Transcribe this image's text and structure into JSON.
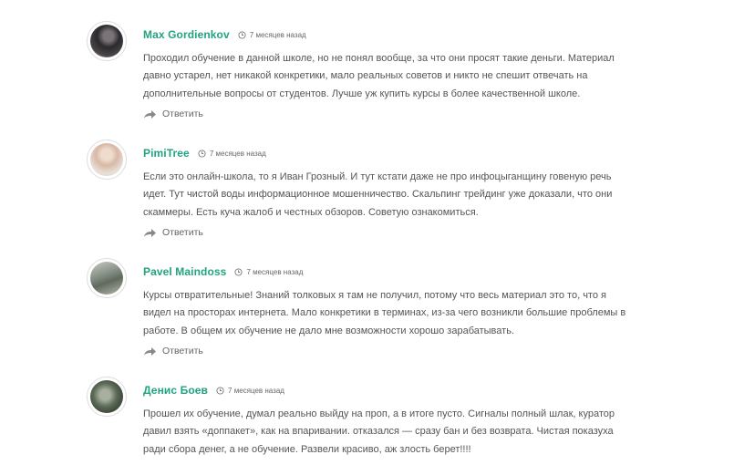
{
  "comments": [
    {
      "author": "Max Gordienkov",
      "time": "7 месяцев назад",
      "text": "Проходил обучение в данной школе, но не понял вообще, за что они просят такие деньги. Материал давно устарел, нет никакой конкретики, мало реальных советов и никто не спешит отвечать на дополнительные вопросы от студентов. Лучше уж купить курсы в более качественной школе.",
      "reply": "Ответить",
      "avatar_color": "#3c3a3e"
    },
    {
      "author": "PimiTree",
      "time": "7 месяцев назад",
      "text": "Если это онлайн-школа, то я Иван Грозный. И тут кстати даже не про инфоцыганщину говеную речь идет. Тут чистой воды информационное мошенничество. Скальпинг трейдинг уже доказали, что они скаммеры. Есть куча жалоб и честных обзоров. Советую ознакомиться.",
      "reply": "Ответить",
      "avatar_color": "#d9c7b6"
    },
    {
      "author": "Pavel Maindoss",
      "time": "7 месяцев назад",
      "text": "Курсы отвратительные! Знаний толковых я там не получил, потому что весь материал это то, что я видел на просторах интернета. Мало конкретики в терминах, из-за чего возникли большие проблемы в работе. В общем их обучение не дало мне возможности хорошо зарабатывать.",
      "reply": "Ответить",
      "avatar_color": "#9aa096"
    },
    {
      "author": "Денис Боев",
      "time": "7 месяцев назад",
      "text": "Прошел их обучение, думал реально выйду на проп, а в итоге пусто. Сигналы полный шлак, куратор давил взять «доппакет», как на впаривании. отказался — сразу бан и без возврата. Чистая показуха ради сбора денег, а не обучение. Развели красиво, аж злость берет!!!!",
      "avatar_color": "#7d8a78"
    }
  ],
  "accent_color": "#22a37f"
}
